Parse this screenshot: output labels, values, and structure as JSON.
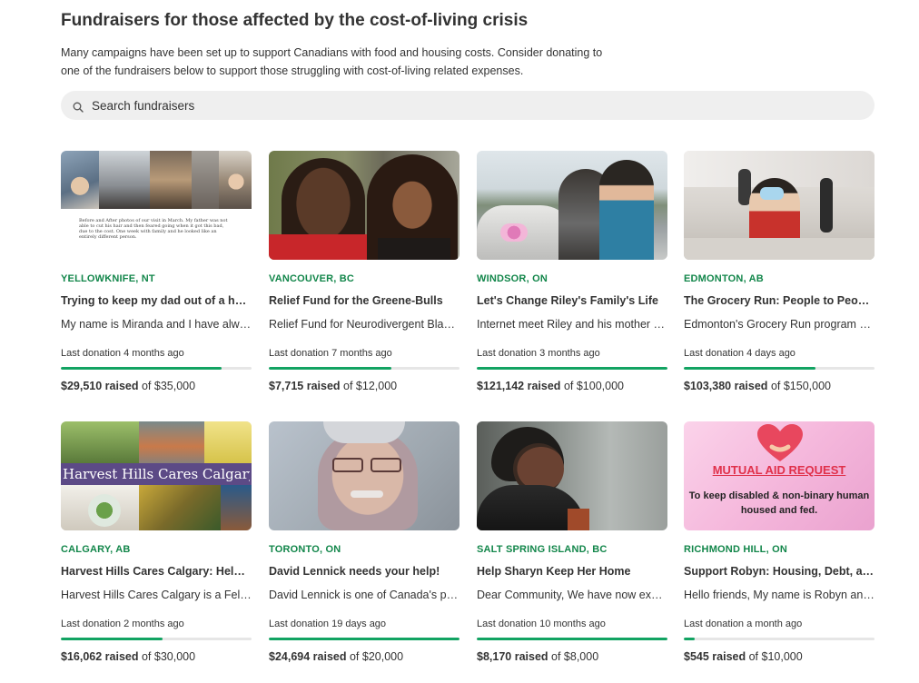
{
  "page": {
    "title": "Fundraisers for those affected by the cost-of-living crisis",
    "intro": "Many campaigns have been set up to support Canadians with food and housing costs. Consider donating to one of the fundraisers below to support those struggling with cost-of-living related expenses."
  },
  "search": {
    "placeholder": "Search fundraisers",
    "icon": "search-icon"
  },
  "colors": {
    "accent_green": "#12864a",
    "progress_green": "#12a362",
    "track_gray": "#e6e6e6",
    "search_bg": "#efefef"
  },
  "fundraisers": [
    {
      "location": "YELLOWKNIFE, NT",
      "title": "Trying to keep my dad out of a homeless shelter",
      "description": "My name is Miranda and I have always been close with my dad",
      "last_donation": "Last donation 4 months ago",
      "raised": "$29,510 raised",
      "goal": "of $35,000",
      "progress": 0.843,
      "image_caption": "Before and After photos of our visit in March. My father was not able to cut his hair and then feared going when it got this bad, due to the cost. One week with family and he looked like an entirely different person."
    },
    {
      "location": "VANCOUVER, BC",
      "title": "Relief Fund for the Greene-Bulls",
      "description": "Relief Fund for Neurodivergent Black family",
      "last_donation": "Last donation 7 months ago",
      "raised": "$7,715 raised",
      "goal": "of $12,000",
      "progress": 0.643
    },
    {
      "location": "WINDSOR, ON",
      "title": "Let's Change Riley's Family's Life",
      "description": "Internet meet Riley and his mother and family",
      "last_donation": "Last donation 3 months ago",
      "raised": "$121,142 raised",
      "goal": "of $100,000",
      "progress": 1.0
    },
    {
      "location": "EDMONTON, AB",
      "title": "The Grocery Run: People to People Program",
      "description": "Edmonton's Grocery Run program helps families",
      "last_donation": "Last donation 4 days ago",
      "raised": "$103,380 raised",
      "goal": "of $150,000",
      "progress": 0.689
    },
    {
      "location": "CALGARY, AB",
      "title": "Harvest Hills Cares Calgary: Help Feed Families",
      "description": "Harvest Hills Cares Calgary is a Fellowship",
      "last_donation": "Last donation 2 months ago",
      "raised": "$16,062 raised",
      "goal": "of $30,000",
      "progress": 0.535,
      "image_caption": "Harvest Hills Cares Calgary"
    },
    {
      "location": "TORONTO, ON",
      "title": "David Lennick needs your help!",
      "description": "David Lennick is one of Canada's premier archivists",
      "last_donation": "Last donation 19 days ago",
      "raised": "$24,694 raised",
      "goal": "of $20,000",
      "progress": 1.0
    },
    {
      "location": "SALT SPRING ISLAND, BC",
      "title": "Help Sharyn Keep Her Home",
      "description": "Dear Community, We have now exceeded our goal",
      "last_donation": "Last donation 10 months ago",
      "raised": "$8,170 raised",
      "goal": "of $8,000",
      "progress": 1.0
    },
    {
      "location": "RICHMOND HILL, ON",
      "title": "Support Robyn: Housing, Debt, and Medical Costs",
      "description": "Hello friends, My name is Robyn and I am",
      "last_donation": "Last donation a month ago",
      "raised": "$545 raised",
      "goal": "of $10,000",
      "progress": 0.055,
      "image_heading": "MUTUAL AID REQUEST",
      "image_text": "To keep disabled & non-binary human housed and fed."
    }
  ]
}
